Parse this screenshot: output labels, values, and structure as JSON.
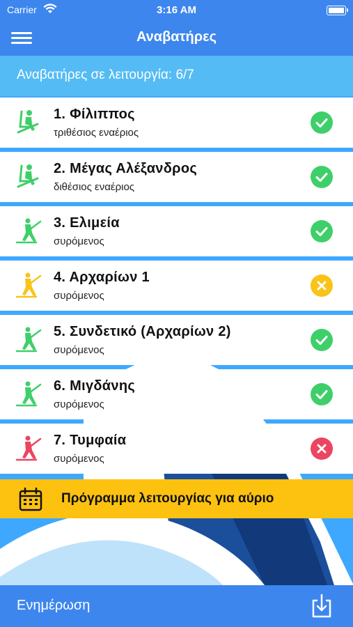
{
  "status_bar": {
    "carrier": "Carrier",
    "time": "3:16 AM"
  },
  "nav": {
    "title": "Αναβατήρες"
  },
  "summary": {
    "text": "Αναβατήρες σε λειτουργία: 6/7"
  },
  "lifts": [
    {
      "name": "1. Φίλιππος",
      "type": "τριθέσιος εναέριος",
      "status": "open",
      "icon": "chairlift-icon"
    },
    {
      "name": "2. Μέγας Αλέξανδρος",
      "type": "διθέσιος εναέριος",
      "status": "open",
      "icon": "chairlift-icon"
    },
    {
      "name": "3. Ελιμεία",
      "type": "συρόμενος",
      "status": "open",
      "icon": "drag-lift-icon"
    },
    {
      "name": "4. Αρχαρίων 1",
      "type": "συρόμενος",
      "status": "paused",
      "icon": "drag-lift-icon"
    },
    {
      "name": "5. Συνδετικό (Αρχαρίων 2)",
      "type": "συρόμενος",
      "status": "open",
      "icon": "drag-lift-icon"
    },
    {
      "name": "6. Μιγδάνης",
      "type": "συρόμενος",
      "status": "open",
      "icon": "drag-lift-icon"
    },
    {
      "name": "7. Τυμφαία",
      "type": "συρόμενος",
      "status": "closed",
      "icon": "drag-lift-icon"
    }
  ],
  "schedule": {
    "label": "Πρόγραμμα λειτουργίας για αύριο",
    "icon": "calendar-icon"
  },
  "footer": {
    "label": "Ενημέρωση",
    "icon": "download-icon"
  },
  "colors": {
    "open": "#3fcf6a",
    "paused": "#f9c318",
    "closed": "#ec4561",
    "header": "#3d86ee",
    "summary": "#55bbf4",
    "schedule": "#fdc110"
  }
}
